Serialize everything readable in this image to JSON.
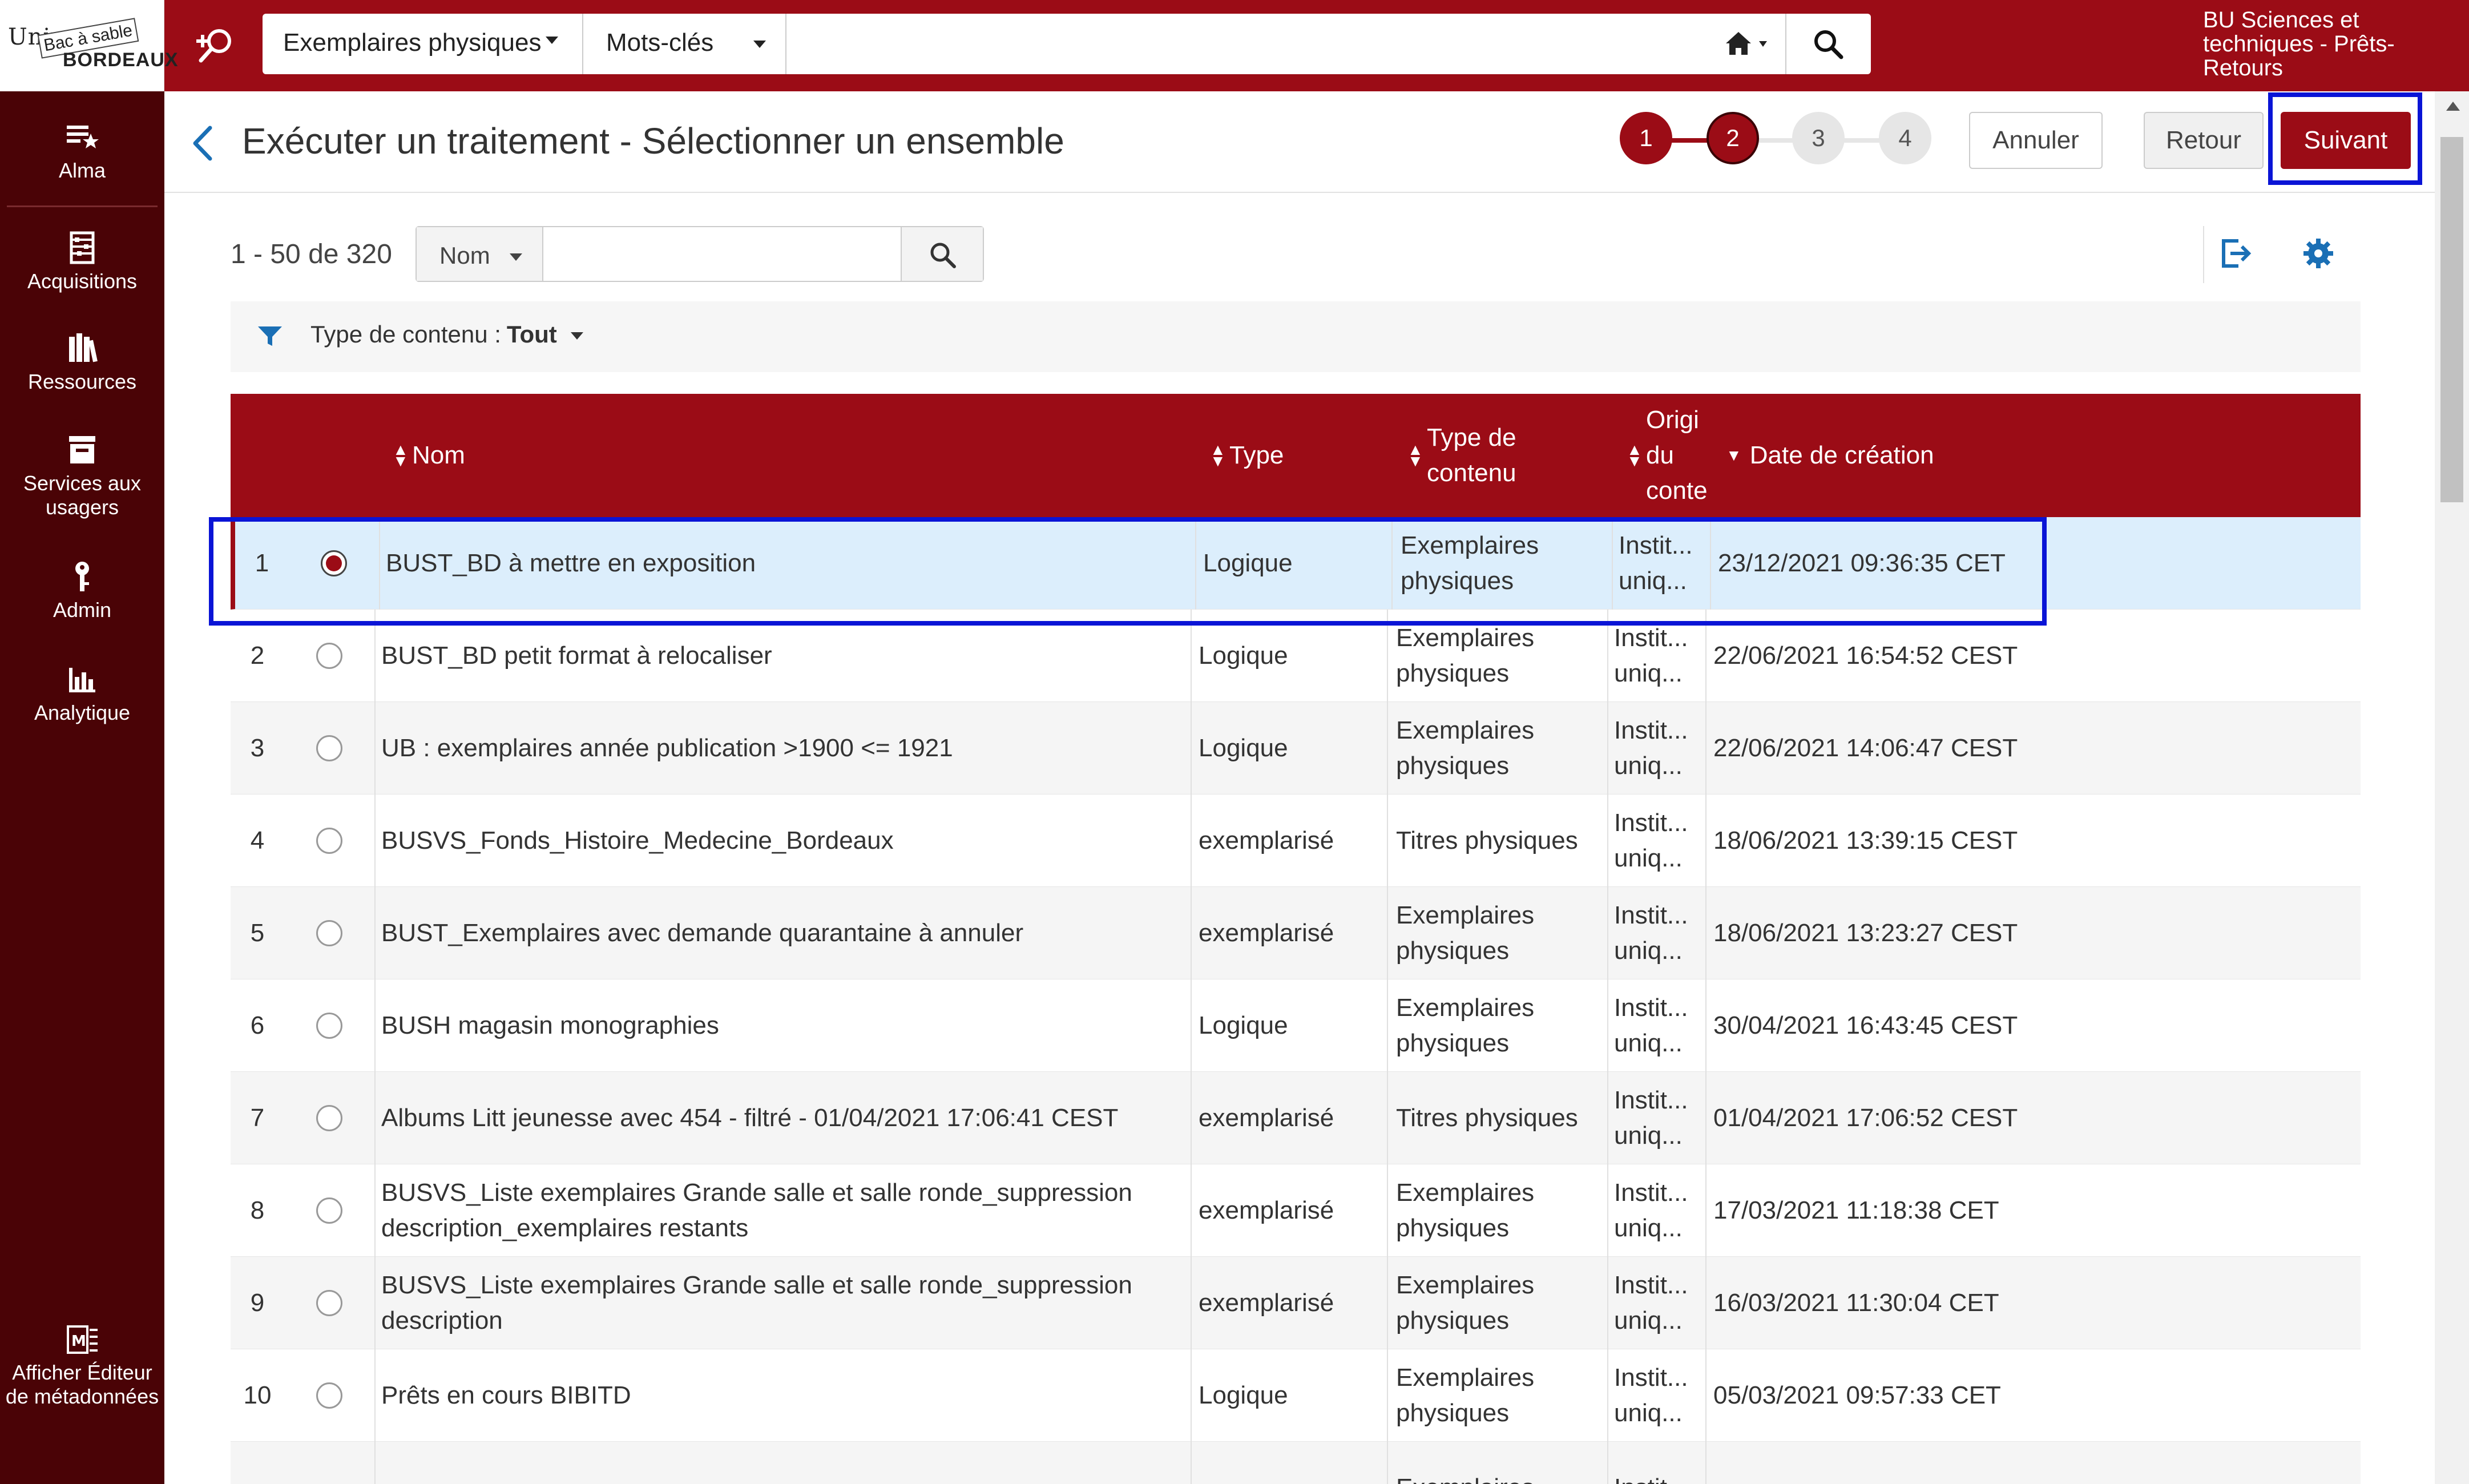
{
  "topbar": {
    "logo": {
      "line1": "Unive",
      "line2": "Bac à sable",
      "line3": "BORDEAUX"
    },
    "search_scope": "Exemplaires physiques",
    "search_field": "Mots-clés",
    "search_value": "",
    "library_name_lines": [
      "BU Sciences et",
      "techniques - Prêts-",
      "Retours"
    ]
  },
  "sidebar": {
    "items": [
      {
        "label": "Alma",
        "icon": "alma-star-icon"
      },
      {
        "label": "Acquisitions",
        "icon": "abacus-icon"
      },
      {
        "label": "Ressources",
        "icon": "books-icon"
      },
      {
        "label": "Services aux usagers",
        "icon": "desk-icon"
      },
      {
        "label": "Admin",
        "icon": "key-icon"
      },
      {
        "label": "Analytique",
        "icon": "bar-chart-icon"
      },
      {
        "label": "Afficher Éditeur de métadonnées",
        "icon": "metadata-editor-icon"
      }
    ]
  },
  "header": {
    "title": "Exécuter un traitement - Sélectionner un ensemble",
    "steps": [
      "1",
      "2",
      "3",
      "4"
    ],
    "current_step": 2,
    "buttons": {
      "cancel": "Annuler",
      "back": "Retour",
      "next": "Suivant"
    }
  },
  "list": {
    "count": "1 - 50 de 320",
    "search_field": "Nom",
    "search_value": "",
    "filter_label": "Type de contenu :",
    "filter_value": "Tout"
  },
  "table": {
    "headers": {
      "name": "Nom",
      "type": "Type",
      "content_type": [
        "Type de",
        "contenu"
      ],
      "origin": [
        "Origi",
        "du",
        "conte"
      ],
      "date": "Date de création"
    },
    "rows": [
      {
        "num": "1",
        "name": [
          "BUST_BD à mettre en exposition"
        ],
        "type": "Logique",
        "content_type": [
          "Exemplaires",
          "physiques"
        ],
        "origin": [
          "Instit...",
          "uniq..."
        ],
        "date": "23/12/2021 09:36:35 CET",
        "selected": true
      },
      {
        "num": "2",
        "name": [
          "BUST_BD petit format à relocaliser"
        ],
        "type": "Logique",
        "content_type": [
          "Exemplaires",
          "physiques"
        ],
        "origin": [
          "Instit...",
          "uniq..."
        ],
        "date": "22/06/2021 16:54:52 CEST",
        "selected": false
      },
      {
        "num": "3",
        "name": [
          "UB : exemplaires année publication >1900 <= 1921"
        ],
        "type": "Logique",
        "content_type": [
          "Exemplaires",
          "physiques"
        ],
        "origin": [
          "Instit...",
          "uniq..."
        ],
        "date": "22/06/2021 14:06:47 CEST",
        "selected": false
      },
      {
        "num": "4",
        "name": [
          "BUSVS_Fonds_Histoire_Medecine_Bordeaux"
        ],
        "type": "exemplarisé",
        "content_type": [
          "Titres physiques"
        ],
        "origin": [
          "Instit...",
          "uniq..."
        ],
        "date": "18/06/2021 13:39:15 CEST",
        "selected": false
      },
      {
        "num": "5",
        "name": [
          "BUST_Exemplaires avec demande quarantaine à annuler"
        ],
        "type": "exemplarisé",
        "content_type": [
          "Exemplaires",
          "physiques"
        ],
        "origin": [
          "Instit...",
          "uniq..."
        ],
        "date": "18/06/2021 13:23:27 CEST",
        "selected": false
      },
      {
        "num": "6",
        "name": [
          "BUSH magasin monographies"
        ],
        "type": "Logique",
        "content_type": [
          "Exemplaires",
          "physiques"
        ],
        "origin": [
          "Instit...",
          "uniq..."
        ],
        "date": "30/04/2021 16:43:45 CEST",
        "selected": false
      },
      {
        "num": "7",
        "name": [
          "Albums Litt jeunesse avec 454 - filtré - 01/04/2021 17:06:41 CEST"
        ],
        "type": "exemplarisé",
        "content_type": [
          "Titres physiques"
        ],
        "origin": [
          "Instit...",
          "uniq..."
        ],
        "date": "01/04/2021 17:06:52 CEST",
        "selected": false
      },
      {
        "num": "8",
        "name": [
          "BUSVS_Liste exemplaires Grande salle et salle ronde_suppression",
          "description_exemplaires restants"
        ],
        "type": "exemplarisé",
        "content_type": [
          "Exemplaires",
          "physiques"
        ],
        "origin": [
          "Instit...",
          "uniq..."
        ],
        "date": "17/03/2021 11:18:38 CET",
        "selected": false
      },
      {
        "num": "9",
        "name": [
          "BUSVS_Liste exemplaires Grande salle et salle ronde_suppression",
          "description"
        ],
        "type": "exemplarisé",
        "content_type": [
          "Exemplaires",
          "physiques"
        ],
        "origin": [
          "Instit...",
          "uniq..."
        ],
        "date": "16/03/2021 11:30:04 CET",
        "selected": false
      },
      {
        "num": "10",
        "name": [
          "Prêts en cours BIBITD"
        ],
        "type": "Logique",
        "content_type": [
          "Exemplaires",
          "physiques"
        ],
        "origin": [
          "Instit...",
          "uniq..."
        ],
        "date": "05/03/2021 09:57:33 CET",
        "selected": false
      },
      {
        "num": "",
        "name": [
          ""
        ],
        "type": "",
        "content_type": [
          "Exemplaires"
        ],
        "origin": [
          "Instit..."
        ],
        "date": "",
        "selected": false
      }
    ]
  },
  "colors": {
    "brand": "#9b0c16",
    "sidebar": "#4a0306",
    "selected_row": "#dceefc",
    "highlight": "#0a14d6"
  }
}
